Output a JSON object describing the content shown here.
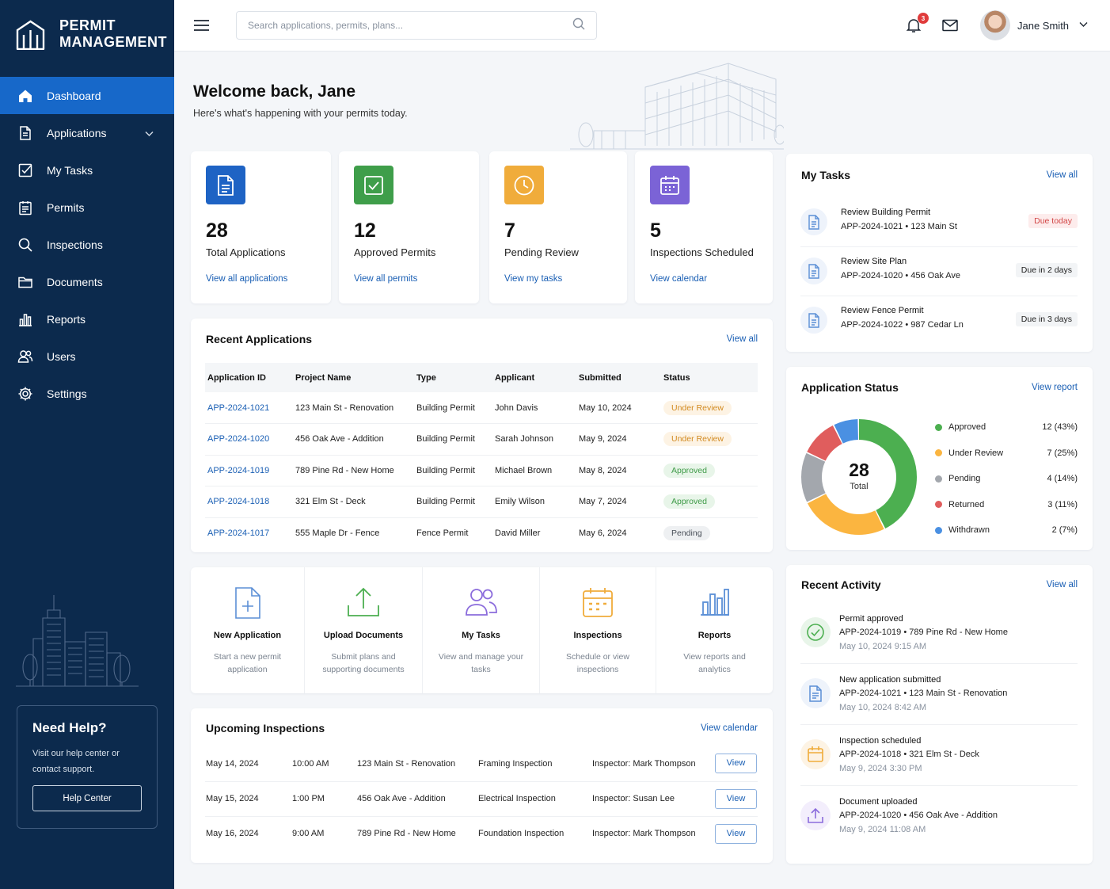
{
  "brand": {
    "line1": "PERMIT",
    "line2": "MANAGEMENT"
  },
  "nav": {
    "items": [
      {
        "label": "Dashboard",
        "icon": "home-icon"
      },
      {
        "label": "Applications",
        "icon": "document-icon"
      },
      {
        "label": "My Tasks",
        "icon": "checkbox-icon"
      },
      {
        "label": "Permits",
        "icon": "clipboard-icon"
      },
      {
        "label": "Inspections",
        "icon": "search-icon"
      },
      {
        "label": "Documents",
        "icon": "folder-icon"
      },
      {
        "label": "Reports",
        "icon": "bar-chart-icon"
      },
      {
        "label": "Users",
        "icon": "users-icon"
      },
      {
        "label": "Settings",
        "icon": "gear-icon"
      }
    ]
  },
  "help": {
    "title": "Need Help?",
    "text": "Visit our help center or contact support.",
    "button": "Help Center"
  },
  "search": {
    "placeholder": "Search applications, permits, plans..."
  },
  "header": {
    "notifications": "3",
    "user_name": "Jane Smith"
  },
  "welcome": {
    "title": "Welcome back, Jane",
    "subtitle": "Here's what's happening with your permits today."
  },
  "stats": [
    {
      "value": "28",
      "label": "Total Applications",
      "link": "View all applications",
      "color": "#1e63c4"
    },
    {
      "value": "12",
      "label": "Approved Permits",
      "link": "View all permits",
      "color": "#3f9e4a"
    },
    {
      "value": "7",
      "label": "Pending Review",
      "link": "View my tasks",
      "color": "#f0ac3b"
    },
    {
      "value": "5",
      "label": "Inspections Scheduled",
      "link": "View calendar",
      "color": "#7b63d6"
    }
  ],
  "recent_apps": {
    "title": "Recent Applications",
    "link": "View all",
    "columns": [
      "Application ID",
      "Project Name",
      "Type",
      "Applicant",
      "Submitted",
      "Status"
    ],
    "rows": [
      {
        "id": "APP-2024-1021",
        "project": "123 Main St - Renovation",
        "type": "Building Permit",
        "applicant": "John Davis",
        "submitted": "May 10, 2024",
        "status": "Under Review"
      },
      {
        "id": "APP-2024-1020",
        "project": "456 Oak Ave - Addition",
        "type": "Building Permit",
        "applicant": "Sarah Johnson",
        "submitted": "May 9, 2024",
        "status": "Under Review"
      },
      {
        "id": "APP-2024-1019",
        "project": "789 Pine Rd - New Home",
        "type": "Building Permit",
        "applicant": "Michael Brown",
        "submitted": "May 8, 2024",
        "status": "Approved"
      },
      {
        "id": "APP-2024-1018",
        "project": "321 Elm St - Deck",
        "type": "Building Permit",
        "applicant": "Emily Wilson",
        "submitted": "May 7, 2024",
        "status": "Approved"
      },
      {
        "id": "APP-2024-1017",
        "project": "555 Maple Dr - Fence",
        "type": "Fence Permit",
        "applicant": "David Miller",
        "submitted": "May 6, 2024",
        "status": "Pending"
      }
    ]
  },
  "quick_actions": [
    {
      "title": "New Application",
      "desc": "Start a new permit application"
    },
    {
      "title": "Upload Documents",
      "desc": "Submit plans and supporting documents"
    },
    {
      "title": "My Tasks",
      "desc": "View and manage your tasks"
    },
    {
      "title": "Inspections",
      "desc": "Schedule or view inspections"
    },
    {
      "title": "Reports",
      "desc": "View reports and analytics"
    }
  ],
  "inspections": {
    "title": "Upcoming Inspections",
    "link": "View calendar",
    "button": "View",
    "rows": [
      {
        "date": "May 14, 2024",
        "time": "10:00 AM",
        "project": "123 Main St - Renovation",
        "type": "Framing Inspection",
        "inspector": "Inspector: Mark Thompson"
      },
      {
        "date": "May 15, 2024",
        "time": "1:00 PM",
        "project": "456 Oak Ave - Addition",
        "type": "Electrical Inspection",
        "inspector": "Inspector: Susan Lee"
      },
      {
        "date": "May 16, 2024",
        "time": "9:00 AM",
        "project": "789 Pine Rd - New Home",
        "type": "Foundation Inspection",
        "inspector": "Inspector: Mark Thompson"
      }
    ]
  },
  "my_tasks": {
    "title": "My Tasks",
    "link": "View all",
    "items": [
      {
        "title": "Review Building Permit",
        "sub": "APP-2024-1021 • 123 Main St",
        "due": "Due today"
      },
      {
        "title": "Review Site Plan",
        "sub": "APP-2024-1020 • 456 Oak Ave",
        "due": "Due in 2 days"
      },
      {
        "title": "Review Fence Permit",
        "sub": "APP-2024-1022 • 987 Cedar Ln",
        "due": "Due in 3 days"
      }
    ]
  },
  "app_status": {
    "title": "Application Status",
    "link": "View report",
    "total": "28",
    "total_label": "Total",
    "items": [
      {
        "label": "Approved",
        "count": 12,
        "display": "12 (43%)",
        "color": "#4caf50"
      },
      {
        "label": "Under Review",
        "count": 7,
        "display": "7 (25%)",
        "color": "#fbb540"
      },
      {
        "label": "Pending",
        "count": 4,
        "display": "4 (14%)",
        "color": "#a3a7ad"
      },
      {
        "label": "Returned",
        "count": 3,
        "display": "3 (11%)",
        "color": "#e05d5d"
      },
      {
        "label": "Withdrawn",
        "count": 2,
        "display": "2 (7%)",
        "color": "#4a90e2"
      }
    ]
  },
  "activity": {
    "title": "Recent Activity",
    "link": "View all",
    "items": [
      {
        "title": "Permit approved",
        "sub": "APP-2024-1019 • 789 Pine Rd - New Home",
        "date": "May 10, 2024 9:15 AM",
        "icon": "check-circle-icon"
      },
      {
        "title": "New application submitted",
        "sub": "APP-2024-1021 • 123 Main St - Renovation",
        "date": "May 10, 2024 8:42 AM",
        "icon": "document-icon"
      },
      {
        "title": "Inspection scheduled",
        "sub": "APP-2024-1018 • 321 Elm St - Deck",
        "date": "May 9, 2024 3:30 PM",
        "icon": "calendar-icon"
      },
      {
        "title": "Document uploaded",
        "sub": "APP-2024-1020 • 456 Oak Ave - Addition",
        "date": "May 9, 2024 11:08 AM",
        "icon": "upload-icon"
      }
    ]
  }
}
